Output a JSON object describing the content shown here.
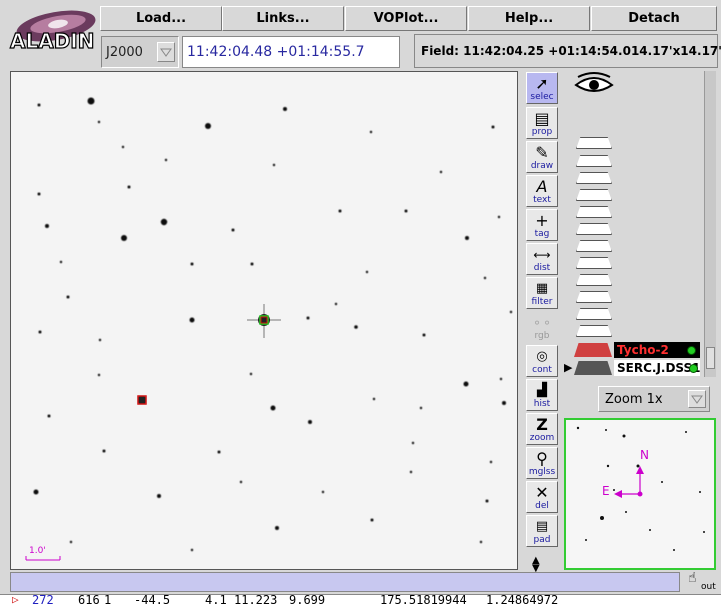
{
  "app": {
    "logo_text": "ALADIN"
  },
  "menu": [
    {
      "label": "Load..."
    },
    {
      "label": "Links..."
    },
    {
      "label": "VOPlot..."
    },
    {
      "label": "Help..."
    },
    {
      "label": "Detach"
    }
  ],
  "frame": {
    "value": "J2000"
  },
  "coord_input": {
    "value": "11:42:04.48 +01:14:55.7"
  },
  "field": {
    "label": "Field:",
    "coords": "11:42:04.25 +01:14:54.0",
    "size": "14.17'x14.17'"
  },
  "view": {
    "scale_label": "1.0'"
  },
  "tools": [
    {
      "label": "selec",
      "icon": "arrow-cursor-icon",
      "state": "active"
    },
    {
      "label": "prop",
      "icon": "properties-icon",
      "state": "normal"
    },
    {
      "label": "draw",
      "icon": "pencil-icon",
      "state": "normal"
    },
    {
      "label": "text",
      "icon": "text-A-icon",
      "state": "normal"
    },
    {
      "label": "tag",
      "icon": "crosshair-icon",
      "state": "normal"
    },
    {
      "label": "dist",
      "icon": "ruler-icon",
      "state": "normal"
    },
    {
      "label": "filter",
      "icon": "filter-icon",
      "state": "normal"
    },
    {
      "label": "rgb",
      "icon": "rgb-circles-icon",
      "state": "disabled"
    },
    {
      "label": "cont",
      "icon": "contour-eye-icon",
      "state": "normal"
    },
    {
      "label": "hist",
      "icon": "histogram-icon",
      "state": "normal"
    },
    {
      "label": "zoom",
      "icon": "zoom-Z-icon",
      "state": "normal"
    },
    {
      "label": "mglss",
      "icon": "magnifier-icon",
      "state": "normal"
    },
    {
      "label": "del",
      "icon": "delete-x-icon",
      "state": "normal"
    },
    {
      "label": "pad",
      "icon": "notepad-icon",
      "state": "normal"
    }
  ],
  "planes": [
    {
      "name": "Tycho-2",
      "color": "#d01010",
      "status_color": "#22cc22"
    },
    {
      "name": "SERC.J.DSS1",
      "color": "#000000",
      "status_color": "#22cc22"
    }
  ],
  "zoom": {
    "value": "Zoom 1x"
  },
  "thumbnail": {
    "north": "N",
    "east": "E"
  },
  "out_button": {
    "label": "out"
  },
  "measurements": {
    "row": [
      "272",
      "616",
      "1",
      "-44.5",
      "4.1",
      "11.223",
      "9.699",
      "175.51819944",
      "1.24864972"
    ]
  },
  "colors": {
    "accent": "#b8b8f0",
    "status_bar": "#c8c8f0",
    "thumbnail_border": "#33cc33",
    "compass": "#cc00cc"
  }
}
